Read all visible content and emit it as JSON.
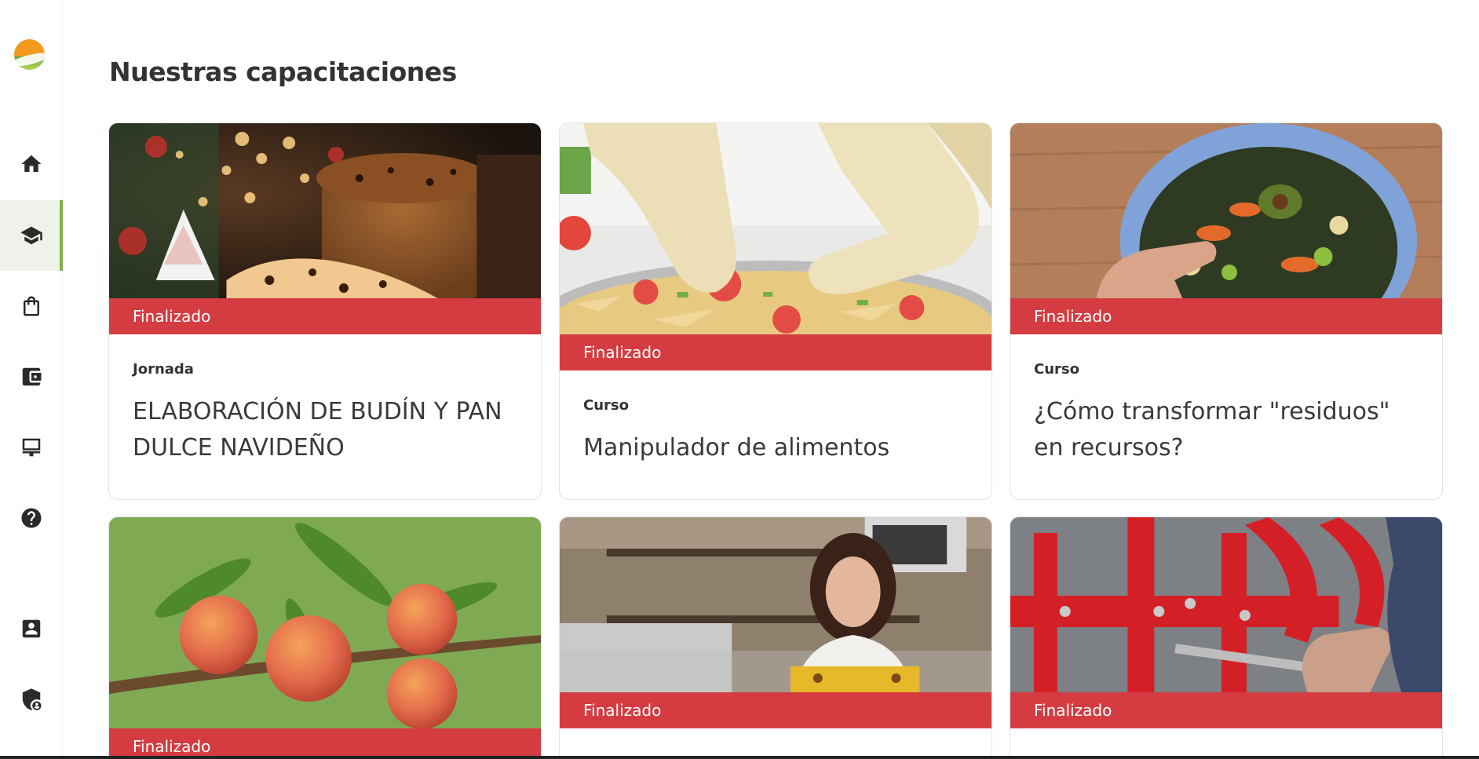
{
  "page": {
    "title": "Nuestras capacitaciones"
  },
  "sidebar": {
    "logo": "logo-icon",
    "items": [
      {
        "name": "home",
        "icon": "home-icon",
        "active": false
      },
      {
        "name": "capacitaciones",
        "icon": "graduation-cap-icon",
        "active": true
      },
      {
        "name": "tienda",
        "icon": "shopping-bag-icon",
        "active": false
      },
      {
        "name": "billetera",
        "icon": "wallet-icon",
        "active": false
      },
      {
        "name": "presentacion",
        "icon": "presentation-board-icon",
        "active": false
      },
      {
        "name": "ayuda",
        "icon": "help-icon",
        "active": false
      },
      {
        "name": "perfil",
        "icon": "contact-card-icon",
        "active": false
      },
      {
        "name": "privacidad",
        "icon": "shield-user-icon",
        "active": false
      }
    ]
  },
  "cards": [
    {
      "status": "Finalizado",
      "type": "Jornada",
      "title": "ELABORACIÓN DE BUDÍN Y PAN DULCE NAVIDEÑO",
      "image": "panettone-photo"
    },
    {
      "status": "Finalizado",
      "type": "Curso",
      "title": "Manipulador de alimentos",
      "image": "gloved-hands-pizza-photo"
    },
    {
      "status": "Finalizado",
      "type": "Curso",
      "title": "¿Cómo transformar \"residuos\" en recursos?",
      "image": "compost-bin-photo"
    },
    {
      "status": "Finalizado",
      "type": "",
      "title": "",
      "image": "peaches-photo"
    },
    {
      "status": "Finalizado",
      "type": "",
      "title": "",
      "image": "cafe-worker-photo"
    },
    {
      "status": "Finalizado",
      "type": "",
      "title": "",
      "image": "red-farm-machinery-photo"
    }
  ],
  "colors": {
    "status_red": "#d43c41",
    "active_green": "#7fb04a",
    "text_dark": "#333333"
  }
}
